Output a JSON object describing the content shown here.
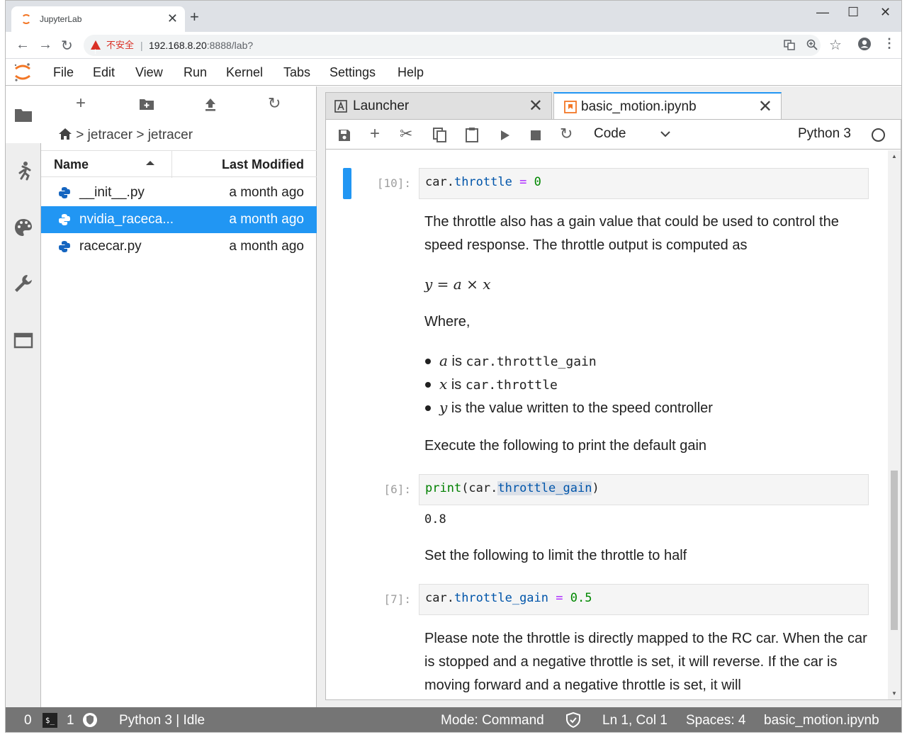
{
  "browser": {
    "tab_title": "JupyterLab",
    "tab_close": "✕",
    "new_tab": "+",
    "window_controls": {
      "minimize": "—",
      "maximize": "☐",
      "close": "✕"
    },
    "security_label": "不安全",
    "separator": "|",
    "url_host": "192.168.8.20",
    "url_path": ":8888/lab?"
  },
  "menu": {
    "items": [
      "File",
      "Edit",
      "View",
      "Run",
      "Kernel",
      "Tabs",
      "Settings",
      "Help"
    ]
  },
  "filebrowser": {
    "breadcrumb": [
      "jetracer",
      "jetracer"
    ],
    "crumb_sep": ">",
    "header": {
      "name": "Name",
      "modified": "Last Modified"
    },
    "files": [
      {
        "name": "__init__.py",
        "modified": "a month ago",
        "selected": false
      },
      {
        "name": "nvidia_raceca...",
        "modified": "a month ago",
        "selected": true
      },
      {
        "name": "racecar.py",
        "modified": "a month ago",
        "selected": false
      }
    ]
  },
  "tabs": [
    {
      "label": "Launcher",
      "close": "✕"
    },
    {
      "label": "basic_motion.ipynb",
      "close": "✕"
    }
  ],
  "toolbar": {
    "cell_type": "Code",
    "kernel_name": "Python 3"
  },
  "notebook": {
    "cell1": {
      "prompt": "[10]:",
      "code": {
        "a": "car.",
        "b": "throttle",
        "c": " = ",
        "d": "0"
      }
    },
    "md1_text": "The throttle also has a gain value that could be used to control the speed response. The throttle output is computed as",
    "equation": {
      "y": "y",
      "eq": " = ",
      "a": "a",
      "times": " × ",
      "x": "x"
    },
    "where": "Where,",
    "bullets": [
      {
        "var": "a",
        "is": " is ",
        "code": "car.throttle_gain",
        "rest": ""
      },
      {
        "var": "x",
        "is": " is ",
        "code": "car.throttle",
        "rest": ""
      },
      {
        "var": "y",
        "is": " is the value written to the speed controller",
        "code": "",
        "rest": ""
      }
    ],
    "exec_text": "Execute the following to print the default gain",
    "cell2": {
      "prompt": "[6]:",
      "code": {
        "fn": "print",
        "p1": "(car.",
        "attr": "throttle_gain",
        "p2": ")"
      },
      "output": "0.8"
    },
    "md3_text": "Set the following to limit the throttle to half",
    "cell3": {
      "prompt": "[7]:",
      "code": {
        "a": "car.",
        "b": "throttle_gain",
        "c": " = ",
        "d": "0.5"
      }
    },
    "md4_text": "Please note the throttle is directly mapped to the RC car. When the car is stopped and a negative throttle is set, it will reverse. If the car is moving forward and a negative throttle is set, it will"
  },
  "statusbar": {
    "num0": "0",
    "terminal": "$_",
    "num1": "1",
    "kernel_status": "Python 3 | Idle",
    "mode": "Mode: Command",
    "position": "Ln 1, Col 1",
    "spaces": "Spaces: 4",
    "filename": "basic_motion.ipynb"
  },
  "colors": {
    "accent": "#2196f3",
    "logo": "#f37726",
    "status_bg": "#757575",
    "warning": "#d93025"
  }
}
